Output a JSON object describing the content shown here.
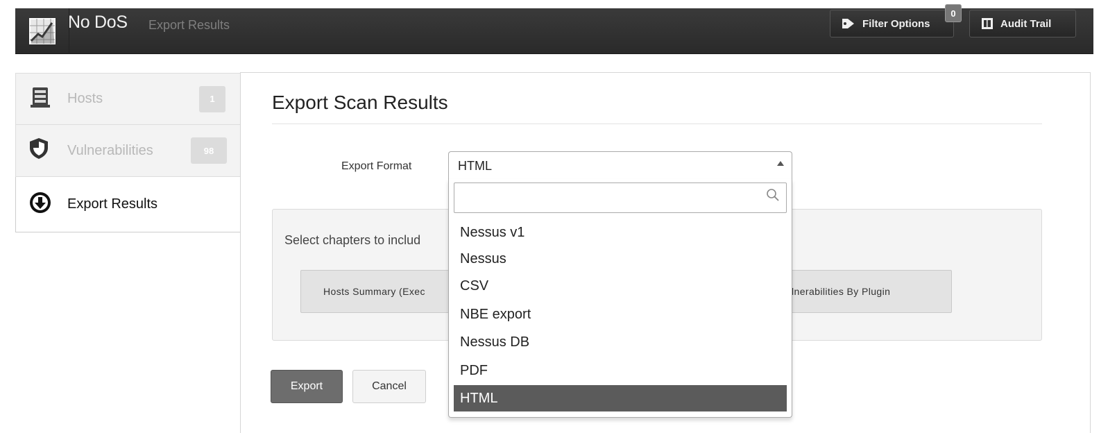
{
  "header": {
    "title": "No DoS",
    "subtitle": "Export Results",
    "filter_label": "Filter Options",
    "filter_count": "0",
    "audit_label": "Audit Trail",
    "icons": [
      "chart-logo-icon",
      "tag-icon",
      "book-icon"
    ]
  },
  "sidebar": {
    "items": [
      {
        "label": "Hosts",
        "count": "1",
        "icon": "server-stack-icon",
        "active": false
      },
      {
        "label": "Vulnerabilities",
        "count": "98",
        "icon": "shield-icon",
        "active": false
      },
      {
        "label": "Export Results",
        "icon": "download-circle-icon",
        "active": true
      }
    ]
  },
  "main": {
    "title": "Export Scan Results",
    "export_format_label": "Export Format",
    "export_format_value": "HTML",
    "chapters_text": "Select chapters to includ",
    "chapter_buttons": [
      "Hosts Summary (Exec",
      "lnerabilities By Plugin"
    ],
    "export_button": "Export",
    "cancel_button": "Cancel"
  },
  "dropdown": {
    "search_value": "",
    "options": [
      "Nessus v1",
      "Nessus",
      "CSV",
      "NBE export",
      "Nessus DB",
      "PDF",
      "HTML"
    ],
    "selected": "HTML"
  },
  "colors": {
    "topbar": "#2f2f2f",
    "selected_option": "#5b5b5b",
    "export_button": "#6d6d6d"
  }
}
